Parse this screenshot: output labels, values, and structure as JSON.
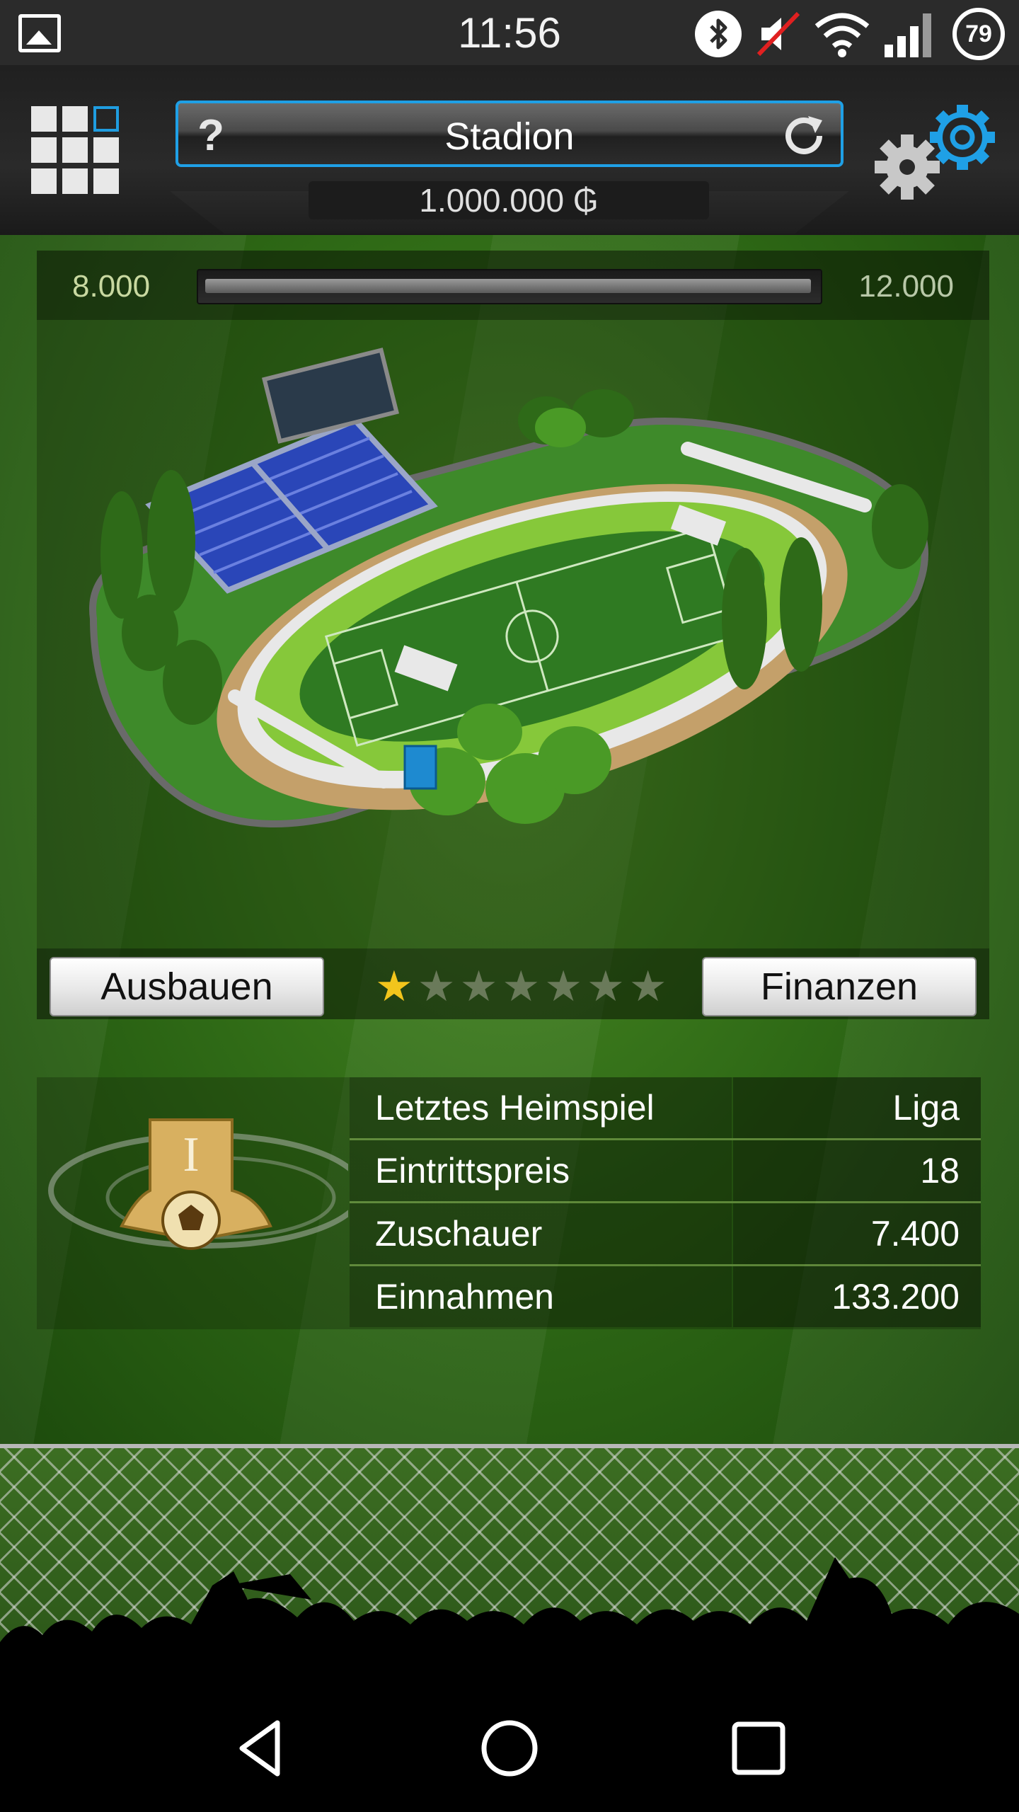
{
  "status_bar": {
    "time": "11:56",
    "battery": "79",
    "icons": [
      "gallery-icon",
      "bluetooth-icon",
      "mute-icon",
      "wifi-icon",
      "signal-icon",
      "battery-icon"
    ]
  },
  "header": {
    "title": "Stadion",
    "money": "1.000.000 ₲",
    "icons": [
      "menu-grid-icon",
      "help-icon",
      "refresh-icon",
      "settings-icon"
    ],
    "accent_color": "#1fa0e6"
  },
  "stadium": {
    "capacity_current": "8.000",
    "capacity_max": "12.000",
    "capacity_fill_fraction": 1.0,
    "upgrade_button": "Ausbauen",
    "finance_button": "Finanzen",
    "stars_total": 7,
    "stars_filled": 1
  },
  "last_home_game": {
    "rows": [
      {
        "label": "Letztes Heimspiel",
        "value": "Liga"
      },
      {
        "label": "Eintrittspreis",
        "value": "18"
      },
      {
        "label": "Zuschauer",
        "value": "7.400"
      },
      {
        "label": "Einnahmen",
        "value": "133.200"
      }
    ],
    "badge_letter": "I"
  },
  "nav": {
    "icons": [
      "back-icon",
      "home-icon",
      "recent-apps-icon"
    ]
  }
}
